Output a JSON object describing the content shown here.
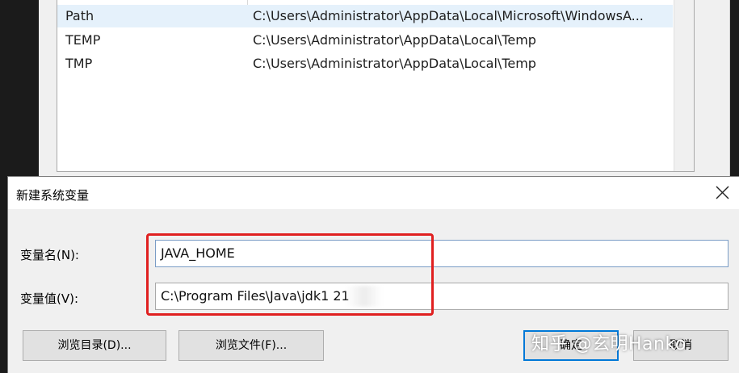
{
  "env_list": {
    "rows": [
      {
        "name": "Path",
        "value": "C:\\Users\\Administrator\\AppData\\Local\\Microsoft\\WindowsA..."
      },
      {
        "name": "TEMP",
        "value": "C:\\Users\\Administrator\\AppData\\Local\\Temp"
      },
      {
        "name": "TMP",
        "value": "C:\\Users\\Administrator\\AppData\\Local\\Temp"
      }
    ]
  },
  "dialog": {
    "title": "新建系统变量",
    "name_label": "变量名(N):",
    "name_value": "JAVA_HOME",
    "value_label": "变量值(V):",
    "value_value": "C:\\Program Files\\Java\\jdk1      21",
    "browse_dir_label": "浏览目录(D)...",
    "browse_file_label": "浏览文件(F)...",
    "ok_label": "确定",
    "cancel_label": "取消"
  },
  "watermark": "知乎 @玄明Hanko",
  "colors": {
    "highlight": "#e02020",
    "selected_row": "#e5f1fb",
    "default_button_border": "#0078d7"
  },
  "icons": {
    "close": "close-icon"
  }
}
